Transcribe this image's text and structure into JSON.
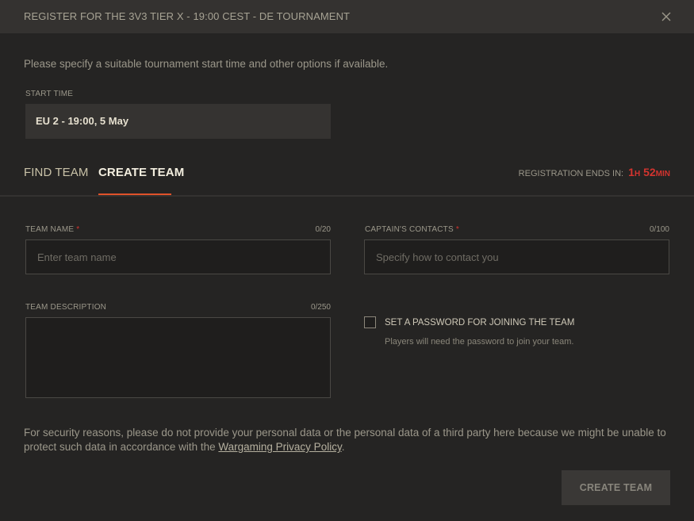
{
  "dialog": {
    "title": "REGISTER FOR THE 3V3 TIER X - 19:00 CEST - DE TOURNAMENT",
    "intro": "Please specify a suitable tournament start time and other options if available."
  },
  "start_time": {
    "label": "START TIME",
    "value": "EU 2 - 19:00, 5 May"
  },
  "tabs": [
    {
      "label": "FIND TEAM",
      "active": false
    },
    {
      "label": "CREATE TEAM",
      "active": true
    }
  ],
  "registration": {
    "label": "REGISTRATION ENDS IN:",
    "hours": "1",
    "hours_unit": "H",
    "minutes": "52",
    "minutes_unit": "MIN"
  },
  "form": {
    "team_name": {
      "label": "TEAM NAME",
      "required_mark": "*",
      "counter": "0/20",
      "placeholder": "Enter team name",
      "value": ""
    },
    "captain_contacts": {
      "label": "CAPTAIN'S CONTACTS",
      "required_mark": "*",
      "counter": "0/100",
      "placeholder": "Specify how to contact you",
      "value": ""
    },
    "team_description": {
      "label": "TEAM DESCRIPTION",
      "counter": "0/250",
      "value": ""
    },
    "password": {
      "label": "SET A PASSWORD FOR JOINING THE TEAM",
      "hint": "Players will need the password to join your team.",
      "checked": false
    }
  },
  "notice": {
    "text": "For security reasons, please do not provide your personal data or the personal data of a third party here because we might be unable to protect such data in accordance with the ",
    "link": "Wargaming Privacy Policy",
    "suffix": "."
  },
  "submit_label": "CREATE TEAM",
  "colors": {
    "accent": "#e0522a",
    "timer": "#d3342f",
    "background": "#252423"
  },
  "icons": {
    "close": "close-icon"
  }
}
